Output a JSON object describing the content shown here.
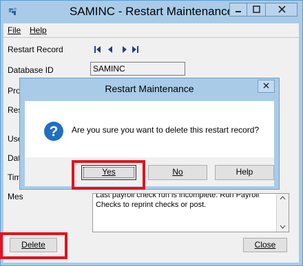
{
  "window": {
    "title": "SAMINC - Restart Maintenance",
    "app_icon": "sage-app-icon",
    "controls": [
      "minimize-icon",
      "maximize-icon",
      "close-icon"
    ]
  },
  "menu": {
    "file": "File",
    "help": "Help"
  },
  "form": {
    "restart_record_label": "Restart Record",
    "nav_icons": [
      "first-record-icon",
      "previous-record-icon",
      "next-record-icon",
      "last-record-icon"
    ],
    "database_id_label": "Database ID",
    "database_id_value": "SAMINC",
    "program_label": "Prog",
    "restart_label": "Res",
    "user_label": "Use",
    "date_label": "Dat",
    "time_label": "Tim",
    "message_label": "Mes",
    "message_text": "Last payroll check run is incomplete. Run Payroll Checks to reprint checks or post."
  },
  "buttons": {
    "delete": "Delete",
    "close": "Close"
  },
  "dialog": {
    "title": "Restart Maintenance",
    "icon": "question-icon",
    "message": "Are you sure you want to delete this restart record?",
    "yes": "Yes",
    "no": "No",
    "help": "Help"
  },
  "highlight_color": "#e8101c"
}
